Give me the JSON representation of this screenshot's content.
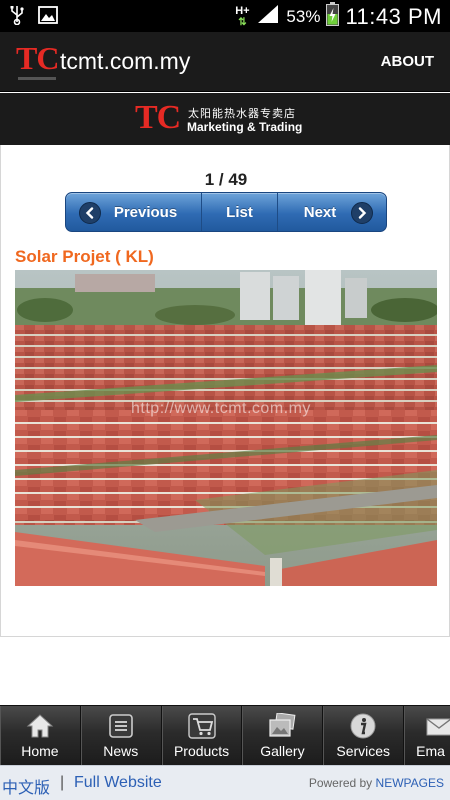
{
  "status_bar": {
    "network": "H+",
    "battery": "53%",
    "time": "11:43 PM",
    "icons": [
      "usb-icon",
      "image-icon",
      "signal-icon",
      "battery-charging-icon"
    ]
  },
  "header": {
    "logo": "TC",
    "site_name": "tcmt.com.my",
    "about_label": "ABOUT"
  },
  "banner": {
    "logo": "TC",
    "chinese": "太阳能热水器专卖店",
    "english": "Marketing & Trading"
  },
  "gallery": {
    "pager": "1 / 49",
    "prev_label": "Previous",
    "list_label": "List",
    "next_label": "Next",
    "title": "Solar Projet ( KL)",
    "watermark": "http://www.tcmt.com.my"
  },
  "nav": {
    "items": [
      {
        "label": "Home",
        "icon": "home-icon"
      },
      {
        "label": "News",
        "icon": "news-icon"
      },
      {
        "label": "Products",
        "icon": "cart-icon"
      },
      {
        "label": "Gallery",
        "icon": "gallery-icon"
      },
      {
        "label": "Services",
        "icon": "info-icon"
      },
      {
        "label": "Ema",
        "icon": "mail-icon"
      }
    ]
  },
  "footer": {
    "chinese_link": "中文版",
    "separator": "|",
    "full_website": "Full Website",
    "powered_by": "Powered by",
    "brand": "NEWPAGES"
  },
  "colors": {
    "accent_orange": "#f0681f",
    "brand_red": "#e62a24",
    "button_blue": "#2f6bb3",
    "link_blue": "#2d60b5"
  }
}
